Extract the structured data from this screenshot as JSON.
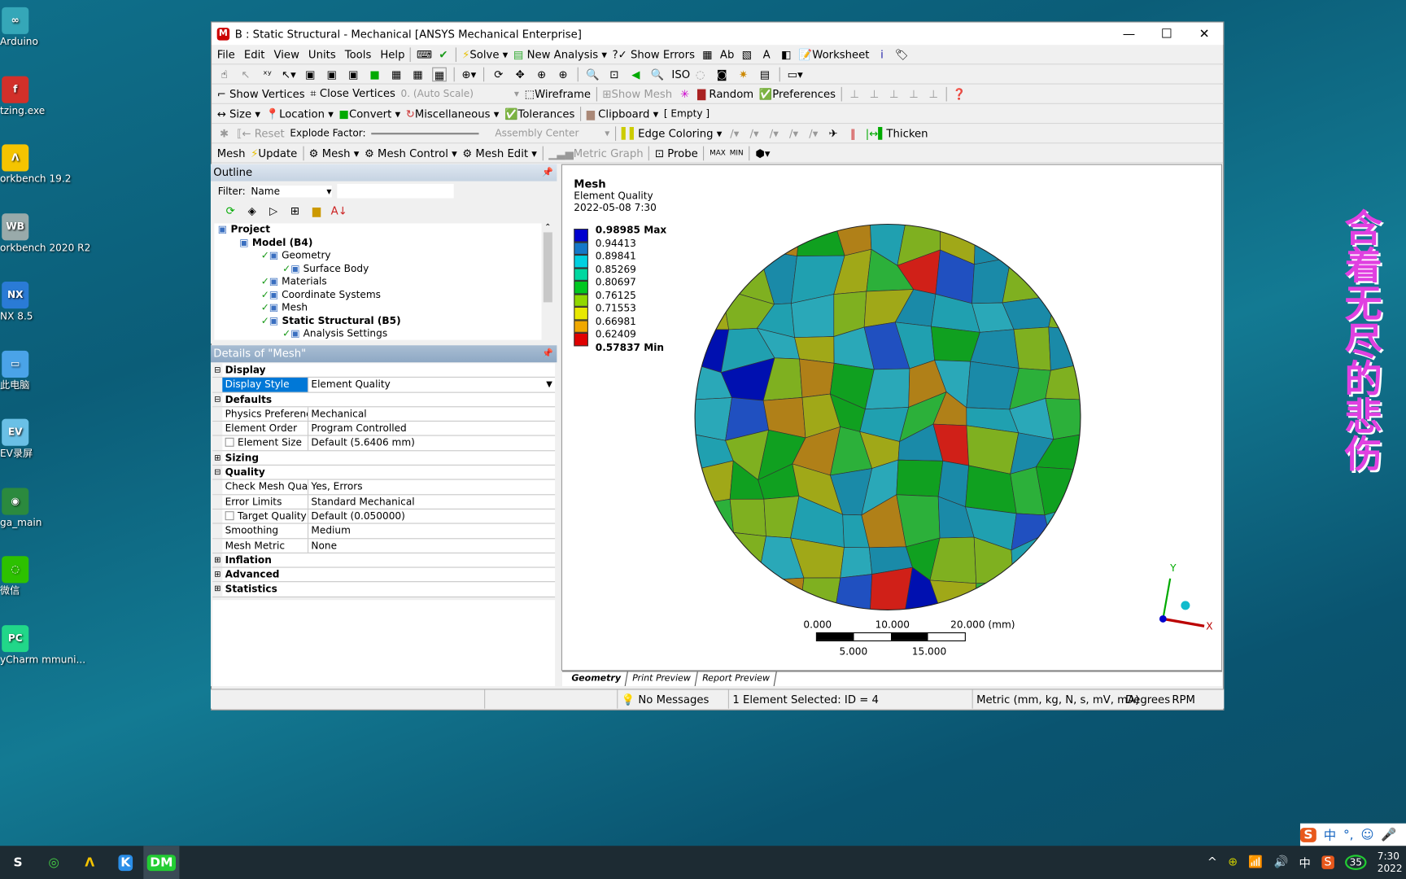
{
  "desktop": {
    "icons": [
      {
        "label": "Arduino",
        "color": "#35a7b8",
        "glyph": "∞"
      },
      {
        "label": "tzing.exe",
        "color": "#d2302a",
        "glyph": "f"
      },
      {
        "label": "orkbench 19.2",
        "color": "#f5c400",
        "glyph": "Λ"
      },
      {
        "label": "orkbench 2020 R2",
        "color": "#9aa",
        "glyph": "WB"
      },
      {
        "label": "NX 8.5",
        "color": "#2a7bd6",
        "glyph": "NX"
      },
      {
        "label": "此电脑",
        "color": "#4aa3e8",
        "glyph": "▭"
      },
      {
        "label": "EV录屏",
        "color": "#6ac0e6",
        "glyph": "EV"
      },
      {
        "label": "ga_main",
        "color": "#2b8a3e",
        "glyph": "◉"
      },
      {
        "label": "微信",
        "color": "#2dc100",
        "glyph": "◌"
      },
      {
        "label": "yCharm mmuni...",
        "color": "#21d789",
        "glyph": "PC"
      }
    ],
    "side_text": "含着无尽的悲伤"
  },
  "window": {
    "title": "B : Static Structural - Mechanical [ANSYS Mechanical Enterprise]",
    "controls": [
      "—",
      "☐",
      "✕"
    ]
  },
  "menu": [
    "File",
    "Edit",
    "View",
    "Units",
    "Tools",
    "Help"
  ],
  "toolbar1": {
    "solve": "Solve",
    "new_analysis": "New Analysis",
    "show_errors": "?✓ Show Errors",
    "worksheet": "Worksheet"
  },
  "toolbar3": {
    "show_vertices": "Show Vertices",
    "close_vertices": "Close Vertices",
    "scale": "0. (Auto Scale)",
    "wireframe": "Wireframe",
    "show_mesh": "Show Mesh",
    "random": "Random",
    "preferences": "Preferences"
  },
  "toolbar4": {
    "size": "Size",
    "location": "Location",
    "convert": "Convert",
    "misc": "Miscellaneous",
    "tolerances": "Tolerances",
    "clipboard": "Clipboard",
    "clipboard_value": "[ Empty ]"
  },
  "toolbar5": {
    "reset": "Reset",
    "explode": "Explode Factor:",
    "assembly": "Assembly Center",
    "edge_coloring": "Edge Coloring",
    "thicken": "Thicken"
  },
  "toolbar6": {
    "mesh_label": "Mesh",
    "update": "Update",
    "mesh": "Mesh",
    "mesh_control": "Mesh Control",
    "mesh_edit": "Mesh Edit",
    "metric_graph": "Metric Graph",
    "probe": "Probe"
  },
  "outline": {
    "title": "Outline",
    "filter_label": "Filter:",
    "filter_value": "Name",
    "tree": [
      {
        "label": "Project",
        "indent": 0,
        "bold": true
      },
      {
        "label": "Model (B4)",
        "indent": 1,
        "bold": true
      },
      {
        "label": "Geometry",
        "indent": 2
      },
      {
        "label": "Surface Body",
        "indent": 3
      },
      {
        "label": "Materials",
        "indent": 2
      },
      {
        "label": "Coordinate Systems",
        "indent": 2
      },
      {
        "label": "Mesh",
        "indent": 2
      },
      {
        "label": "Static Structural (B5)",
        "indent": 2,
        "bold": true
      },
      {
        "label": "Analysis Settings",
        "indent": 3
      }
    ]
  },
  "details": {
    "title": "Details of \"Mesh\"",
    "rows": [
      {
        "group": true,
        "k": "Display",
        "ex": "−"
      },
      {
        "k": "Display Style",
        "v": "Element Quality",
        "sel": true
      },
      {
        "group": true,
        "k": "Defaults",
        "ex": "−"
      },
      {
        "k": "Physics Preference",
        "v": "Mechanical"
      },
      {
        "k": "Element Order",
        "v": "Program Controlled"
      },
      {
        "k": "Element Size",
        "v": "Default (5.6406 mm)",
        "cb": true
      },
      {
        "group": true,
        "k": "Sizing",
        "ex": "+"
      },
      {
        "group": true,
        "k": "Quality",
        "ex": "−"
      },
      {
        "k": "Check Mesh Qual...",
        "v": "Yes, Errors"
      },
      {
        "k": "Error Limits",
        "v": "Standard Mechanical"
      },
      {
        "k": "Target Quality",
        "v": "Default (0.050000)",
        "cb": true
      },
      {
        "k": "Smoothing",
        "v": "Medium"
      },
      {
        "k": "Mesh Metric",
        "v": "None"
      },
      {
        "group": true,
        "k": "Inflation",
        "ex": "+"
      },
      {
        "group": true,
        "k": "Advanced",
        "ex": "+"
      },
      {
        "group": true,
        "k": "Statistics",
        "ex": "+"
      }
    ]
  },
  "graphics": {
    "title": "Mesh",
    "subtitle": "Element Quality",
    "date": "2022-05-08 7:30",
    "legend": [
      {
        "v": "0.98985 Max",
        "c": "#0000d0"
      },
      {
        "v": "0.94413",
        "c": "#1478c8"
      },
      {
        "v": "0.89841",
        "c": "#00d0e0"
      },
      {
        "v": "0.85269",
        "c": "#00d8a0"
      },
      {
        "v": "0.80697",
        "c": "#00c820"
      },
      {
        "v": "0.76125",
        "c": "#90d800"
      },
      {
        "v": "0.71553",
        "c": "#e8e800"
      },
      {
        "v": "0.66981",
        "c": "#f0a800"
      },
      {
        "v": "0.62409",
        "c": "#e00000"
      },
      {
        "v": "0.57837 Min",
        "c": ""
      }
    ],
    "mesh_colors": [
      "#1a8aa8",
      "#2aa8b8",
      "#20a0b0",
      "#7fb020",
      "#a0a818",
      "#b08018",
      "#2cb03a",
      "#10a020",
      "#2050c0",
      "#0010b0",
      "#d02018"
    ],
    "scale": {
      "top": [
        "0.000",
        "10.000",
        "20.000 (mm)"
      ],
      "bottom": [
        "5.000",
        "15.000"
      ]
    },
    "axes": {
      "y": "Y",
      "x": "X"
    },
    "tabs": [
      "Geometry",
      "Print Preview",
      "Report Preview"
    ]
  },
  "status": {
    "messages": "No Messages",
    "selection": "1 Element Selected: ID = 4",
    "units": "Metric (mm, kg, N, s, mV, mA)",
    "angle": "Degrees",
    "speed": "RPM"
  },
  "taskbar": {
    "apps": [
      "S",
      "◎",
      "Λ",
      "K",
      "DM"
    ],
    "tray": [
      "^",
      "中",
      "35"
    ],
    "time": "7:30",
    "date": "2022"
  }
}
